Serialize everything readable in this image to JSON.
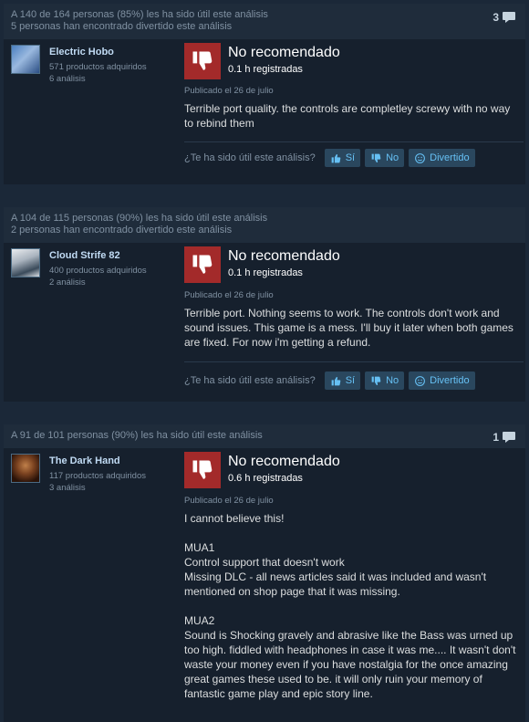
{
  "reviews": [
    {
      "helpful_text": "A 140 de 164 personas (85%) les ha sido útil este análisis",
      "funny_text": "5 personas han encontrado divertido este análisis",
      "comment_count": "3",
      "author": {
        "name": "Electric Hobo",
        "products": "571 productos adquiridos",
        "reviews": "6 análisis"
      },
      "verdict": "No recomendado",
      "hours": "0.1 h registradas",
      "posted": "Publicado el 26 de julio",
      "content": [
        "Terrible port quality. the controls are completley screwy with no way to rebind them"
      ]
    },
    {
      "helpful_text": "A 104 de 115 personas (90%) les ha sido útil este análisis",
      "funny_text": "2 personas han encontrado divertido este análisis",
      "comment_count": "",
      "author": {
        "name": "Cloud Strife 82",
        "products": "400 productos adquiridos",
        "reviews": "2 análisis"
      },
      "verdict": "No recomendado",
      "hours": "0.1 h registradas",
      "posted": "Publicado el 26 de julio",
      "content": [
        "Terrible port. Nothing seems to work. The controls don't work and sound issues. This game is a mess. I'll buy it later when both games are fixed. For now i'm getting a refund."
      ]
    },
    {
      "helpful_text": "A 91 de 101 personas (90%) les ha sido útil este análisis",
      "funny_text": "",
      "comment_count": "1",
      "author": {
        "name": "The Dark Hand",
        "products": "117 productos adquiridos",
        "reviews": "3 análisis"
      },
      "verdict": "No recomendado",
      "hours": "0.6 h registradas",
      "posted": "Publicado el 26 de julio",
      "content": [
        "I cannot believe this!",
        "MUA1\nControl support that doesn't work\nMissing DLC - all news articles said it was included and wasn't mentioned on shop page that it was missing.",
        "MUA2\nSound is Shocking gravely and abrasive like the Bass was urned up too high. fiddled with headphones in case it was me.... It wasn't don't waste your money even if you have nostalgia for the once amazing great games these used to be. it will only ruin your memory of fantastic game play and epic story line."
      ]
    }
  ],
  "labels": {
    "helpful_question": "¿Te ha sido útil este análisis?",
    "yes": "Sí",
    "no": "No",
    "funny": "Divertido"
  },
  "colors": {
    "background": "#1b2838",
    "negative": "#a32a2a",
    "button_bg": "#2a475e",
    "button_text": "#66c0f4"
  },
  "icons": {
    "comment": "speech-bubble-icon",
    "thumbs_down": "thumbs-down-icon",
    "yes": "thumbs-up-icon",
    "no": "thumbs-down-icon",
    "funny": "smiley-icon"
  }
}
